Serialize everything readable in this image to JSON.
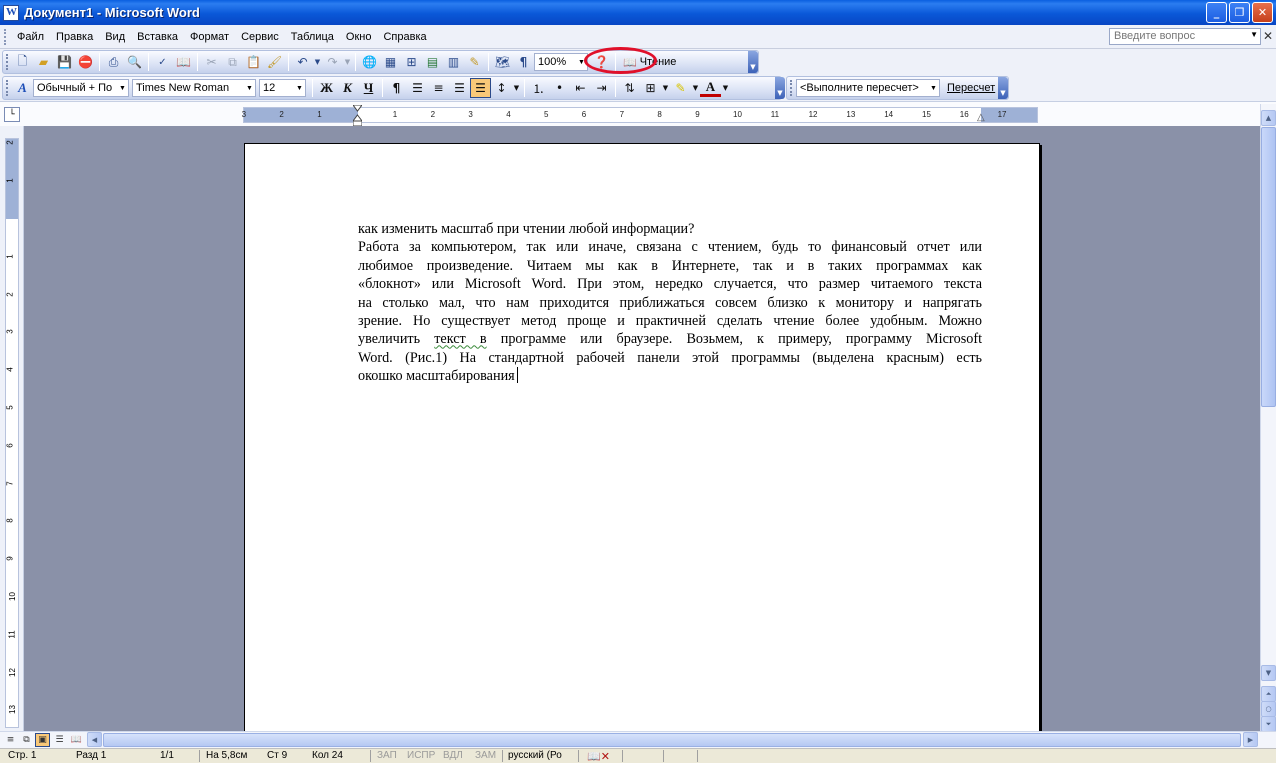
{
  "window": {
    "title": "Документ1 - Microsoft Word"
  },
  "menu": {
    "items": [
      "Файл",
      "Правка",
      "Вид",
      "Вставка",
      "Формат",
      "Сервис",
      "Таблица",
      "Окно",
      "Справка"
    ],
    "help_placeholder": "Введите вопрос"
  },
  "standard_toolbar": {
    "zoom_value": "100%",
    "reading_label": "Чтение",
    "icons": [
      "new-icon",
      "open-icon",
      "save-icon",
      "permission-icon",
      "print-icon",
      "print-preview-icon",
      "spelling-icon",
      "research-icon",
      "cut-icon",
      "copy-icon",
      "paste-icon",
      "format-painter-icon",
      "undo-icon",
      "redo-icon",
      "hyperlink-icon",
      "tables-borders-icon",
      "insert-table-icon",
      "insert-excel-icon",
      "columns-icon",
      "drawing-icon",
      "document-map-icon",
      "show-hide-icon",
      "help-icon"
    ]
  },
  "formatting_toolbar": {
    "style_value": "Обычный + По",
    "font_value": "Times New Roman",
    "size_value": "12",
    "bold_label": "Ж",
    "italic_label": "К",
    "underline_label": "Ч",
    "recalc_combo": "<Выполните пересчет>",
    "recalc_button": "Пересчет"
  },
  "ruler": {
    "horizontal_ticks": [
      "3",
      "2",
      "1",
      "1",
      "2",
      "3",
      "4",
      "5",
      "6",
      "7",
      "8",
      "9",
      "10",
      "11",
      "12",
      "13",
      "14",
      "15",
      "16",
      "17"
    ],
    "vertical_ticks": [
      "2",
      "1",
      "1",
      "2",
      "3",
      "4",
      "5",
      "6",
      "7",
      "8",
      "9",
      "10",
      "11",
      "12",
      "13"
    ]
  },
  "document": {
    "lines": [
      "как изменить масштаб при чтении любой информации?",
      "Работа за компьютером, так или иначе, связана с чтением, будь то финансовый отчет или",
      "любимое произведение. Читаем мы как в Интернете, так и в таких программах как",
      "«блокнот» или Microsoft Word. При этом, нередко случается, что размер читаемого текста",
      "на столько мал, что нам приходится приближаться совсем близко к монитору и напрягать",
      "зрение. Но существует метод проще и практичней сделать чтение более удобным. Можно",
      "увеличить текст в программе или браузере. Возьмем, к примеру, программу Microsoft",
      "Word. (Рис.1) На стандартной рабочей панели этой программы (выделена красным) есть",
      "окошко масштабирования"
    ]
  },
  "statusbar": {
    "page": "Стр. 1",
    "section": "Разд 1",
    "pages": "1/1",
    "at": "На 5,8см",
    "line": "Ст 9",
    "col": "Кол 24",
    "rec": "ЗАП",
    "trk": "ИСПР",
    "ext": "ВДЛ",
    "ovr": "ЗАМ",
    "language": "русский (Ро"
  },
  "colors": {
    "titlebar": "#0a58d8",
    "zoom_highlight": "#e0102a",
    "workspace": "#8a91a8"
  }
}
